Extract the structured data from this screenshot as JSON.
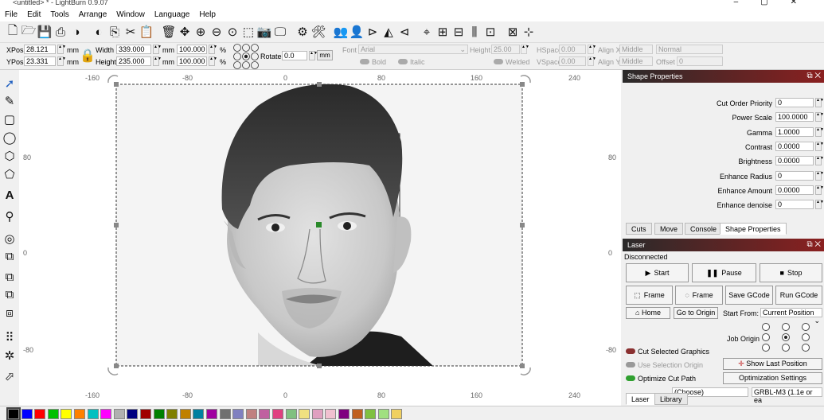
{
  "window": {
    "title": "<untitled> * - LightBurn 0.9.07"
  },
  "menu": [
    "File",
    "Edit",
    "Tools",
    "Arrange",
    "Window",
    "Language",
    "Help"
  ],
  "toolbar": {
    "icons": [
      "new-file",
      "open",
      "save",
      "import",
      "undo",
      "redo",
      "copy",
      "cut",
      "paste",
      "delete",
      "move",
      "zoom-in",
      "zoom-out",
      "zoom-fit",
      "select-frame",
      "camera",
      "monitor",
      "settings",
      "tools",
      "users",
      "user",
      "flip-h",
      "mirror",
      "flip-v",
      "target",
      "align-a",
      "align-b",
      "align-c",
      "align-d",
      "distribute-a",
      "distribute-b"
    ]
  },
  "numbar": {
    "xpos_label": "XPos",
    "xpos": "28.121",
    "ypos_label": "YPos",
    "ypos": "23.331",
    "unit": "mm",
    "width_label": "Width",
    "width": "339.000",
    "height_label": "Height",
    "height": "235.000",
    "scale_w": "100.000",
    "scale_h": "100.000",
    "pct": "%",
    "rotate_label": "Rotate",
    "rotate": "0.0",
    "rotate_unit": "mm",
    "font_label": "Font",
    "font": "Arial",
    "fheight_label": "Height",
    "fheight": "25.00",
    "hspace_label": "HSpace",
    "hspace": "0.00",
    "vspace_label": "VSpace",
    "vspace": "0.00",
    "alignx_label": "Align X",
    "alignx": "Middle",
    "aligny_label": "Align Y",
    "aligny": "Middle",
    "normal": "Normal",
    "offset_label": "Offset",
    "offset": "0",
    "bold": "Bold",
    "italic": "Italic",
    "welded": "Welded"
  },
  "canvas": {
    "top_ticks": [
      "-160",
      "-80",
      "0",
      "80",
      "160",
      "240"
    ],
    "bottom_ticks": [
      "-160",
      "-80",
      "0",
      "80",
      "160",
      "240"
    ],
    "left_ticks": [
      "80",
      "0",
      "-80"
    ],
    "right_ticks": [
      "80",
      "0",
      "-80"
    ]
  },
  "shape_properties": {
    "title": "Shape Properties",
    "rows": [
      {
        "label": "Cut Order Priority",
        "value": "0"
      },
      {
        "label": "Power Scale",
        "value": "100.0000"
      },
      {
        "label": "Gamma",
        "value": "1.0000"
      },
      {
        "label": "Contrast",
        "value": "0.0000"
      },
      {
        "label": "Brightness",
        "value": "0.0000"
      },
      {
        "label": "Enhance Radius",
        "value": "0"
      },
      {
        "label": "Enhance Amount",
        "value": "0.0000"
      },
      {
        "label": "Enhance denoise",
        "value": "0"
      }
    ],
    "tabs": [
      "Cuts",
      "Move",
      "Console",
      "Shape Properties"
    ]
  },
  "laser": {
    "title": "Laser",
    "status": "Disconnected",
    "start": "Start",
    "pause": "Pause",
    "stop": "Stop",
    "frame1": "Frame",
    "frame2": "Frame",
    "save_gcode": "Save GCode",
    "run_gcode": "Run GCode",
    "home": "Home",
    "goto_origin": "Go to Origin",
    "start_from_label": "Start From:",
    "start_from": "Current Position",
    "job_origin": "Job Origin",
    "cut_selected": "Cut Selected Graphics",
    "use_selection_origin": "Use Selection Origin",
    "optimize": "Optimize Cut Path",
    "show_last": "Show Last Position",
    "opt_settings": "Optimization Settings",
    "device_partial": "(Choose)",
    "device": "GRBL-M3 (1.1e or ea",
    "tabs": [
      "Laser",
      "Library"
    ]
  },
  "palette": [
    "#000000",
    "#0000ff",
    "#ff0000",
    "#00c000",
    "#ffff00",
    "#ff8000",
    "#00c0c0",
    "#ff00ff",
    "#b0b0b0",
    "#000080",
    "#a00000",
    "#008000",
    "#808000",
    "#c08000",
    "#0080a0",
    "#a000a0",
    "#707070",
    "#8080c0",
    "#c08080",
    "#c060a0",
    "#e04080",
    "#80c080",
    "#f0e080",
    "#e0a0c0",
    "#f0c0d0",
    "#800080",
    "#c06020",
    "#80c040",
    "#a0e080",
    "#f0d060"
  ]
}
